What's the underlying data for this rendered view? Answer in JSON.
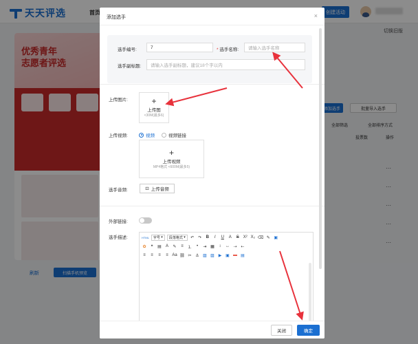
{
  "app": {
    "logo_text": "天天评选",
    "nav_home": "首页",
    "create_button": "创建活动",
    "switch_account": "切换旧版"
  },
  "preview": {
    "title_line1": "优秀青年",
    "title_line2": "志愿者评选",
    "refresh": "刷新",
    "scan_button": "扫描手机预览"
  },
  "table": {
    "add_button": "添加选手",
    "import_button": "批量导入选手",
    "filter_all": "全部筛选",
    "sort_all": "全部排序方式",
    "col_votes": "投票数",
    "col_actions": "操作",
    "row_action": "⋯"
  },
  "modal": {
    "title": "添加选手",
    "close": "×",
    "number_label": "选手编号:",
    "number_value": "7",
    "name_label": "选手名称:",
    "name_required": "*",
    "name_placeholder": "请输入选手名称",
    "subtitle_label": "选手副标题:",
    "subtitle_placeholder": "请输入选手副标题，建议18个字以内",
    "image_label": "上传图片:",
    "image_upload_title": "上传图",
    "image_upload_hint": "<30M(最多6)",
    "video_label": "上传视频:",
    "video_radio_1": "视频",
    "video_radio_2": "视频链接",
    "video_upload_title": "上传视频",
    "video_upload_hint": "MP4格式 <600M(最多5)",
    "audio_label": "选手音频:",
    "audio_button": "上传音频",
    "external_link_label": "外部链接:",
    "description_label": "选手描述:",
    "editor_font_select": "字号",
    "editor_paragraph_select": "段落格式",
    "cancel_button": "关闭",
    "ok_button": "确定"
  },
  "colors": {
    "primary": "#1b6fd1",
    "annotation_arrow": "#e8323c",
    "overlay": "rgba(0,0,0,0.45)"
  }
}
